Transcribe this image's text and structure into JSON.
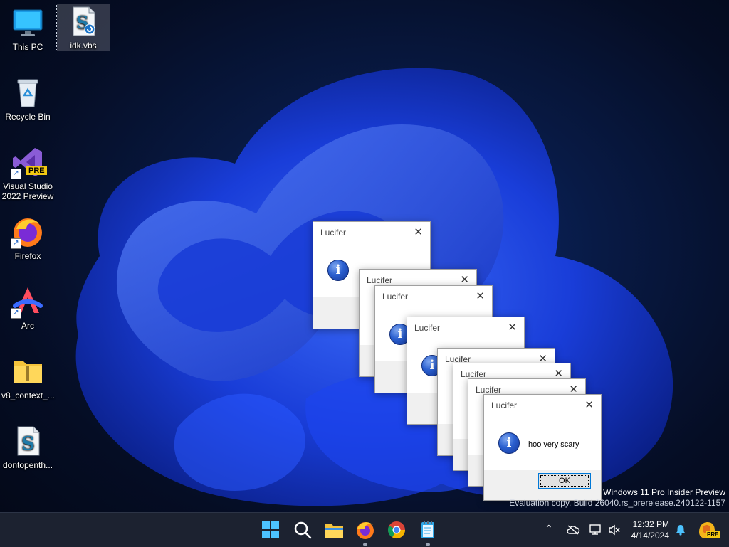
{
  "desktop": {
    "icons": [
      {
        "label": "This PC"
      },
      {
        "label": "idk.vbs"
      },
      {
        "label": "Recycle Bin"
      },
      {
        "label": "Visual Studio 2022 Preview",
        "badge": "PRE"
      },
      {
        "label": "Firefox"
      },
      {
        "label": "Arc"
      },
      {
        "label": "v8_context_..."
      },
      {
        "label": "dontopenth..."
      }
    ]
  },
  "dialogs": {
    "title": "Lucifer",
    "message": "hoo very scary",
    "ok_label": "OK",
    "close_glyph": "✕",
    "info_glyph": "i"
  },
  "watermark": {
    "line1": "Windows 11 Pro Insider Preview",
    "line2": "Evaluation copy. Build 26040.rs_prerelease.240122-1157"
  },
  "taskbar": {
    "time": "12:32 PM",
    "date": "4/14/2024",
    "copilot_badge": "PRE",
    "apps": [
      {
        "name": "start"
      },
      {
        "name": "search"
      },
      {
        "name": "file-explorer"
      },
      {
        "name": "firefox"
      },
      {
        "name": "chrome"
      },
      {
        "name": "notepad"
      }
    ]
  },
  "colors": {
    "accent": "#0078d7",
    "taskbar": "#1c2230",
    "wallpaper_blue": "#1f4fff"
  }
}
